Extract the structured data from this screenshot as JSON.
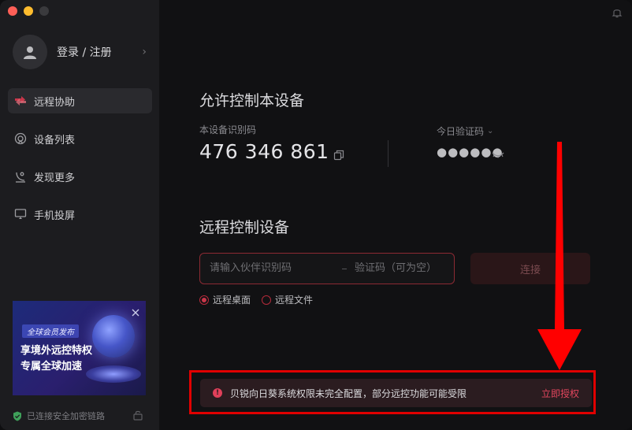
{
  "sidebar": {
    "user": {
      "label": "登录 / 注册",
      "chevron": "›"
    },
    "items": [
      {
        "label": "远程协助",
        "icon": "remote-assist-icon",
        "active": true
      },
      {
        "label": "设备列表",
        "icon": "device-list-icon",
        "active": false
      },
      {
        "label": "发现更多",
        "icon": "discover-icon",
        "active": false
      },
      {
        "label": "手机投屏",
        "icon": "screen-cast-icon",
        "active": false
      }
    ],
    "promo": {
      "badge": "全球会员发布",
      "line1": "享境外远控特权",
      "line2": "专属全球加速"
    },
    "secure_status": "已连接安全加密链路"
  },
  "allow": {
    "title": "允许控制本设备",
    "id_label": "本设备识别码",
    "id_value": "476 346 861",
    "code_label": "今日验证码",
    "code_chevron": "⌄",
    "code_value": "●●●●●●"
  },
  "remote": {
    "title": "远程控制设备",
    "partner_placeholder": "请输入伙伴识别码",
    "code_placeholder": "验证码（可为空）",
    "connect_label": "连接",
    "options": [
      {
        "label": "远程桌面",
        "selected": true
      },
      {
        "label": "远程文件",
        "selected": false
      }
    ]
  },
  "alert": {
    "text": "贝锐向日葵系统权限未完全配置，部分远控功能可能受限",
    "action": "立即授权",
    "icon": "!"
  },
  "colors": {
    "accent": "#c8374a",
    "annotation": "#e00000",
    "sidebar_bg": "#1c1c1f",
    "main_bg": "#111113"
  }
}
